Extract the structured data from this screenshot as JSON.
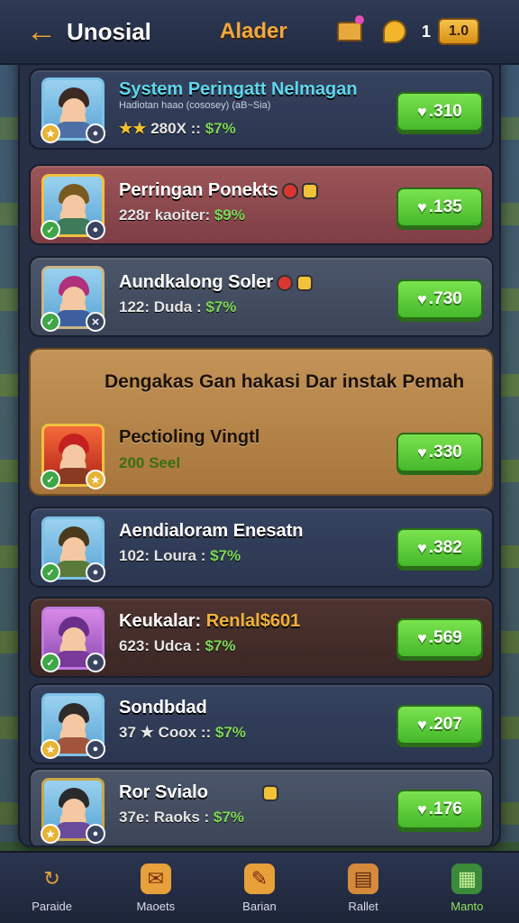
{
  "header": {
    "app_title": "Unosial",
    "center_title": "Alader",
    "coin_count": "1",
    "coin_badge": "1.0",
    "back_icon": "back-arrow-icon",
    "chest_icon": "chest-icon",
    "bell_icon": "bell-icon"
  },
  "cards": [
    {
      "title": "System Peringatt Nelmagan",
      "subtitle": "Hadiotan haao (cososey) (aB~Sia)",
      "stars": "★★",
      "stats_text": " 280X :: ",
      "price": "$7%",
      "button": ".310"
    },
    {
      "title": "Perringan Ponekts",
      "stats_text": "228r kaoiter: ",
      "price": "$9%",
      "button": ".135"
    },
    {
      "title": "Aundkalong Soler",
      "stats_text": "122: Duda : ",
      "price": "$7%",
      "button": ".730"
    },
    {
      "featured_title": "Dengakas Gan hakasi Dar instak Pemah",
      "title": "Pectioling Vingtl",
      "price": "200 Seel",
      "button": ".330"
    },
    {
      "title": "Aendialoram Enesatn",
      "stats_text": "102: Loura : ",
      "price": "$7%",
      "button": ".382"
    },
    {
      "title": "Keukalar: ",
      "title_highlight": "Renlal$601",
      "stats_text": "623: Udca : ",
      "price": "$7%",
      "button": ".569"
    },
    {
      "title": "Sondbdad",
      "stats_text": "37 ★ Coox :: ",
      "price": "$7%",
      "button": ".207"
    },
    {
      "title": "Ror Svialo",
      "stats_text": "37e: Raoks : ",
      "price": "$7%",
      "button": ".176"
    }
  ],
  "nav": [
    {
      "label": "Paraide",
      "icon": "refresh-icon"
    },
    {
      "label": "Maoets",
      "icon": "mail-icon"
    },
    {
      "label": "Barian",
      "icon": "quill-icon"
    },
    {
      "label": "Rallet",
      "icon": "book-icon"
    },
    {
      "label": "Manto",
      "icon": "grid-icon"
    }
  ],
  "colors": {
    "accent": "#f2a93b",
    "buy_green": "#45b82a",
    "price_green": "#7ed957",
    "panel": "#262f44"
  }
}
